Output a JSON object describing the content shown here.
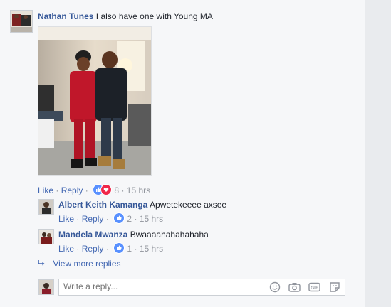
{
  "main_comment": {
    "author": "Nathan Tunes",
    "text": "I also have one with Young MA",
    "actions": {
      "like": "Like",
      "sep1": "·",
      "reply": "Reply",
      "sep2": "·",
      "reaction_count": "8",
      "sep3": "·",
      "time": "15 hrs"
    }
  },
  "replies": [
    {
      "author": "Albert Keith Kamanga",
      "text": "Apwetekeeee axsee",
      "actions": {
        "like": "Like",
        "sep1": "·",
        "reply": "Reply",
        "sep2": "·",
        "reaction_count": "2",
        "sep3": "·",
        "time": "15 hrs"
      }
    },
    {
      "author": "Mandela Mwanza",
      "text": "Bwaaaahahahahaha",
      "actions": {
        "like": "Like",
        "sep1": "·",
        "reply": "Reply",
        "sep2": "·",
        "reaction_count": "1",
        "sep3": "·",
        "time": "15 hrs"
      }
    }
  ],
  "view_more": {
    "label": "View more replies"
  },
  "reply_box": {
    "placeholder": "Write a reply...",
    "icons": [
      "emoji-icon",
      "camera-icon",
      "gif-icon",
      "sticker-icon"
    ]
  },
  "colors": {
    "name": "#365899",
    "link": "#4267b2",
    "muted": "#90949c",
    "like": "#5890ff",
    "love": "#f0284a"
  }
}
